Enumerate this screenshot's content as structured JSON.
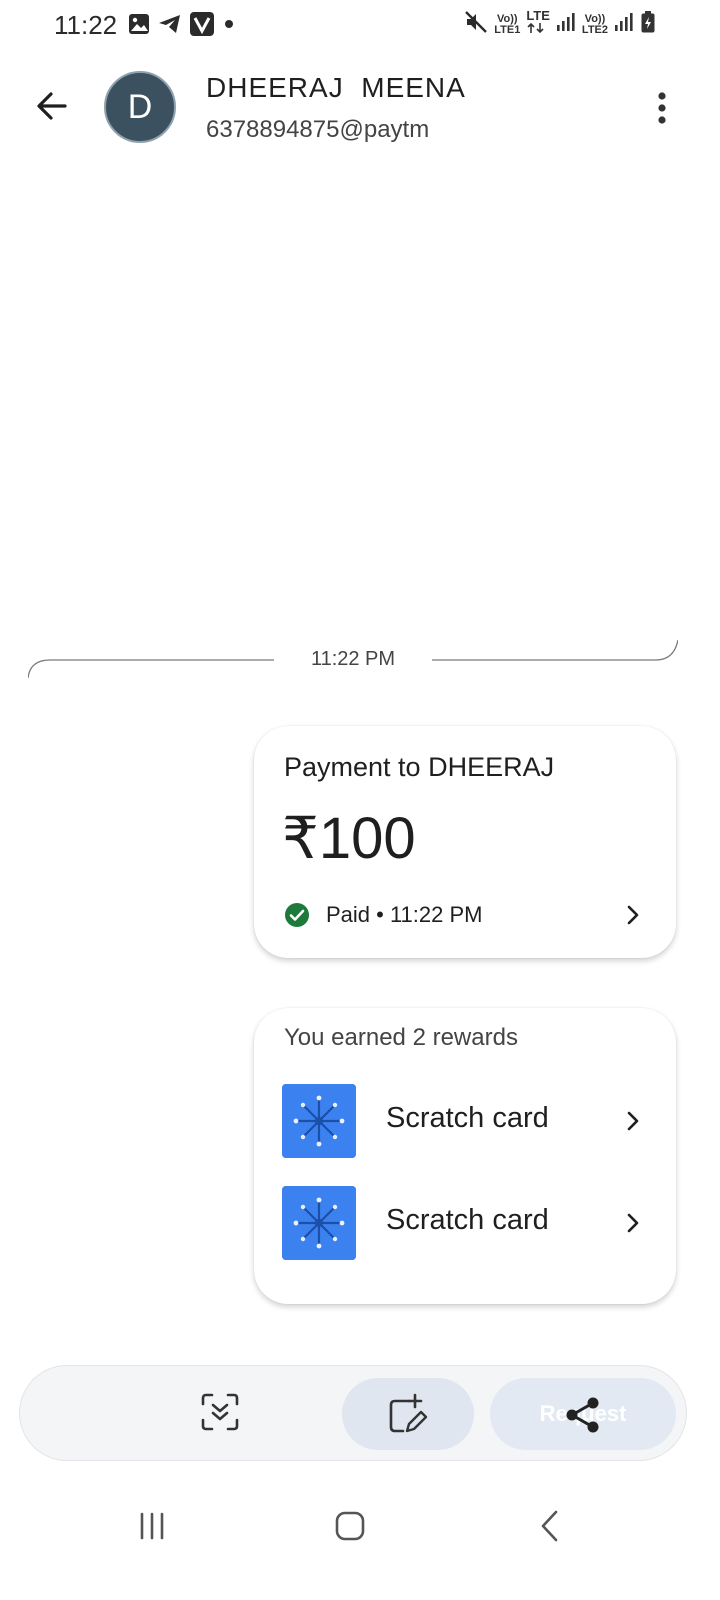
{
  "status_bar": {
    "time": "11:22",
    "left_icons": [
      "gallery-icon",
      "telegram-icon",
      "v-app-icon",
      "dot-icon"
    ],
    "right_icons": [
      "mute-icon",
      "volte-lte1-icon",
      "lte-data-icon",
      "signal-1-icon",
      "volte-lte2-icon",
      "signal-2-icon",
      "battery-icon"
    ],
    "volte1_top": "Vo))",
    "volte1_bottom": "LTE1",
    "lte_label": "LTE",
    "volte2_top": "Vo))",
    "volte2_bottom": "LTE2"
  },
  "header": {
    "avatar_letter": "D",
    "name": "DHEERAJ  MEENA",
    "upi_id": "6378894875@paytm"
  },
  "chat": {
    "timestamp": "11:22 PM"
  },
  "payment": {
    "title": "Payment to DHEERAJ",
    "amount": "₹100",
    "status": "Paid • 11:22 PM",
    "status_color": "#1e7a3c"
  },
  "rewards": {
    "title": "You earned 2 rewards",
    "items": [
      {
        "label": "Scratch card"
      },
      {
        "label": "Scratch card"
      }
    ],
    "thumb_color": "#3b82f0"
  },
  "action_bar": {
    "request_label": "Request"
  }
}
